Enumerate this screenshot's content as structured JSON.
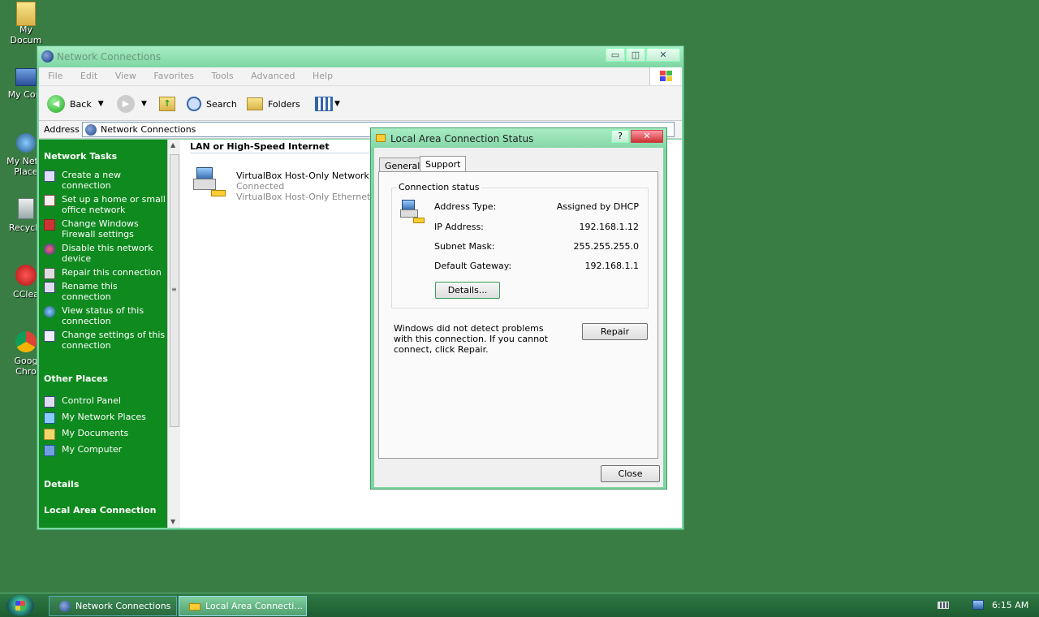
{
  "desktop": {
    "icons": [
      {
        "label": "My\nDocum",
        "icon": "folder-icon"
      },
      {
        "label": "My Com",
        "icon": "computer-icon"
      },
      {
        "label": "My Netw\nPlace",
        "icon": "network-icon"
      },
      {
        "label": "Recycle",
        "icon": "recycle-bin-icon"
      },
      {
        "label": "CClea",
        "icon": "ccleaner-icon"
      },
      {
        "label": "Goog\nChro",
        "icon": "chrome-icon"
      }
    ]
  },
  "explorer": {
    "title": "Network Connections",
    "controls": {
      "minimize": "▭",
      "restore": "◫",
      "close": "✕"
    },
    "menu": [
      "File",
      "Edit",
      "View",
      "Favorites",
      "Tools",
      "Advanced",
      "Help"
    ],
    "toolbar": {
      "back": "Back",
      "search": "Search",
      "folders": "Folders"
    },
    "address": {
      "label": "Address",
      "value": "Network Connections"
    },
    "left_pane": {
      "network_tasks_header": "Network Tasks",
      "network_tasks": [
        "Create a new connection",
        "Set up a home or small office network",
        "Change Windows Firewall settings",
        "Disable this network device",
        "Repair this connection",
        "Rename this connection",
        "View status of this connection",
        "Change settings of this connection"
      ],
      "other_places_header": "Other Places",
      "other_places": [
        "Control Panel",
        "My Network Places",
        "My Documents",
        "My Computer"
      ],
      "details_header": "Details",
      "details_item": "Local Area Connection"
    },
    "content": {
      "group_header": "LAN or High-Speed Internet",
      "connection": {
        "name": "VirtualBox Host-Only Network",
        "status": "Connected",
        "device": "VirtualBox Host-Only Ethernet A"
      }
    }
  },
  "status_dialog": {
    "title": "Local Area Connection Status",
    "help_btn": "?",
    "close_btn": "✕",
    "tabs": [
      "General",
      "Support"
    ],
    "active_tab": "Support",
    "connection_status_label": "Connection status",
    "fields": [
      {
        "key": "Address Type:",
        "value": "Assigned by DHCP"
      },
      {
        "key": "IP Address:",
        "value": "192.168.1.12"
      },
      {
        "key": "Subnet Mask:",
        "value": "255.255.255.0"
      },
      {
        "key": "Default Gateway:",
        "value": "192.168.1.1"
      }
    ],
    "details_button": "Details...",
    "message": "Windows did not detect problems with this connection. If you cannot connect, click Repair.",
    "repair_button": "Repair",
    "close_button": "Close"
  },
  "taskbar": {
    "tasks": [
      "Network Connections",
      "Local Area Connecti..."
    ],
    "clock": "6:15 AM"
  }
}
